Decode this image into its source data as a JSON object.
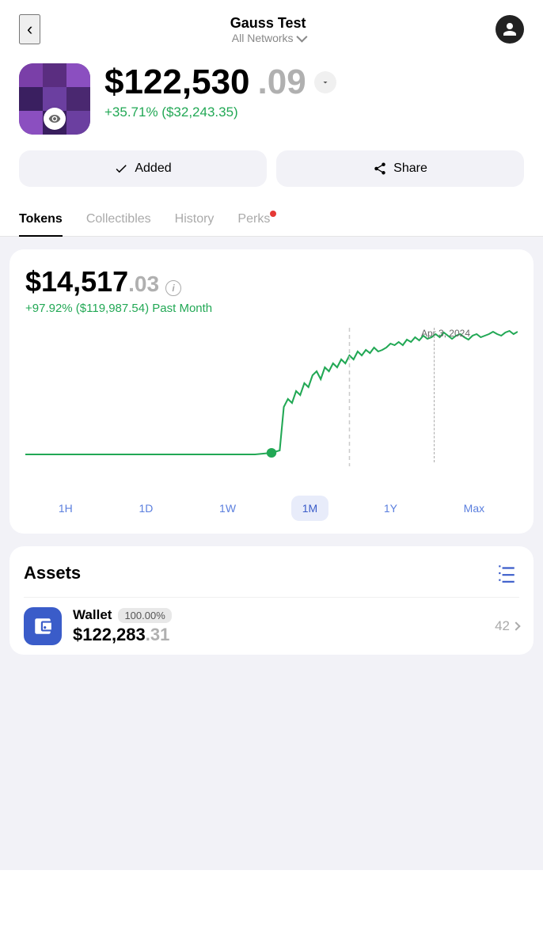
{
  "header": {
    "title": "Gauss Test",
    "subtitle": "All Networks",
    "back_label": "‹",
    "back_aria": "Back"
  },
  "profile": {
    "balance_main": "$122,530",
    "balance_cents": ".09",
    "balance_change": "+35.71% ($32,243.35)"
  },
  "actions": {
    "added_label": "Added",
    "share_label": "Share"
  },
  "tabs": [
    {
      "id": "tokens",
      "label": "Tokens",
      "active": true
    },
    {
      "id": "collectibles",
      "label": "Collectibles",
      "active": false
    },
    {
      "id": "history",
      "label": "History",
      "active": false
    },
    {
      "id": "perks",
      "label": "Perks",
      "active": false,
      "has_dot": true
    }
  ],
  "chart": {
    "balance_main": "$14,517",
    "balance_cents": ".03",
    "change_text": "+97.92% ($119,987.54) Past Month",
    "date_label": "Apr 3, 2024",
    "info_label": "i"
  },
  "time_filters": [
    {
      "id": "1h",
      "label": "1H",
      "active": false
    },
    {
      "id": "1d",
      "label": "1D",
      "active": false
    },
    {
      "id": "1w",
      "label": "1W",
      "active": false
    },
    {
      "id": "1m",
      "label": "1M",
      "active": true
    },
    {
      "id": "1y",
      "label": "1Y",
      "active": false
    },
    {
      "id": "max",
      "label": "Max",
      "active": false
    }
  ],
  "assets": {
    "title": "Assets",
    "wallet_name": "Wallet",
    "wallet_pct": "100.00%",
    "wallet_count": "42",
    "wallet_balance_main": "$122,283",
    "wallet_balance_cents": ".31"
  }
}
